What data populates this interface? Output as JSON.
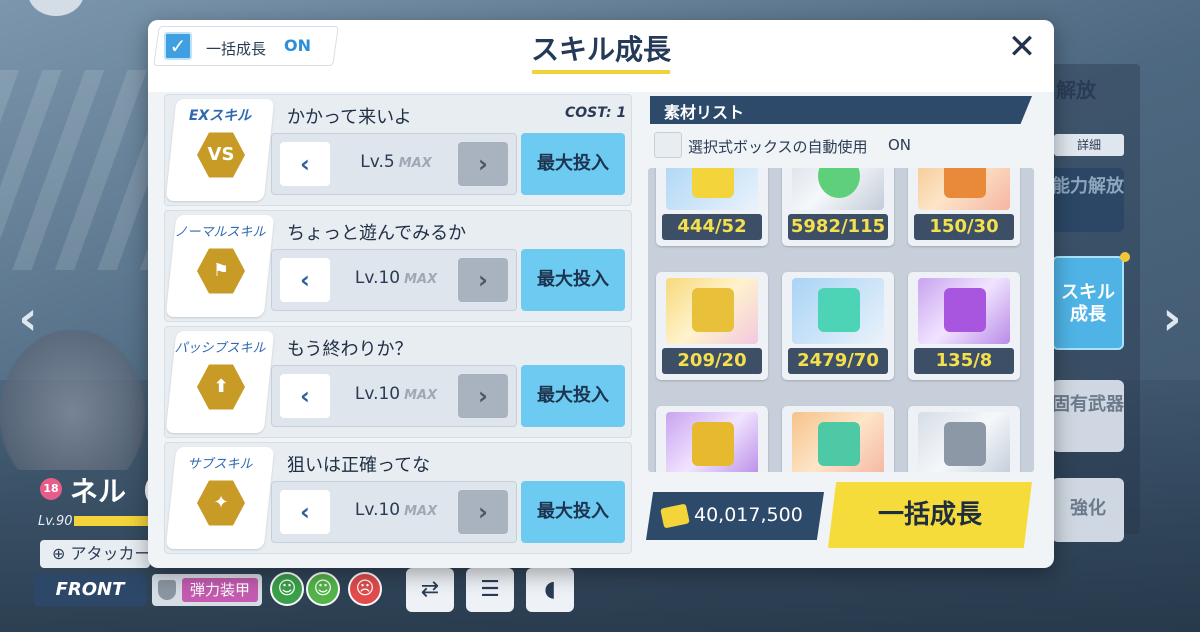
{
  "background": {
    "right_panel": {
      "title": "解放",
      "detail": "詳細",
      "buttons": [
        "能力解放",
        "スキル成長",
        "固有武器",
        "強化"
      ]
    },
    "character": {
      "heart_level": "18",
      "name": "ネル（",
      "level": "Lv.90",
      "role": "アタッカー",
      "position": "FRONT",
      "armor": "弾力装甲"
    }
  },
  "modal": {
    "bulk_toggle": {
      "label": "一括成長",
      "state": "ON"
    },
    "title": "スキル成長",
    "close": "✕"
  },
  "skills": [
    {
      "type": "EXスキル",
      "name": "かかって来いよ",
      "cost_label": "COST",
      "cost": ": 1",
      "level": "Lv.5",
      "max_tag": "MAX",
      "button": "最大投入",
      "icon": "VS"
    },
    {
      "type": "ノーマルスキル",
      "name": "ちょっと遊んでみるか",
      "level": "Lv.10",
      "max_tag": "MAX",
      "button": "最大投入",
      "icon": "⚑"
    },
    {
      "type": "パッシブスキル",
      "name": "もう終わりか？",
      "level": "Lv.10",
      "max_tag": "MAX",
      "button": "最大投入",
      "icon": "⬆"
    },
    {
      "type": "サブスキル",
      "name": "狙いは正確ってな",
      "level": "Lv.10",
      "max_tag": "MAX",
      "button": "最大投入",
      "icon": "✦"
    }
  ],
  "materials": {
    "title": "素材リスト",
    "auto_use_label": "選択式ボックスの自動使用",
    "auto_use_state": "ON",
    "items": [
      {
        "name": "gold-trophy-icon",
        "count": "444/52",
        "color": "#f3d43a"
      },
      {
        "name": "green-orbs-icon",
        "count": "5982/115",
        "color": "#5ecf7a"
      },
      {
        "name": "ex-disc-orange-icon",
        "count": "150/30",
        "color": "#e98a3b"
      },
      {
        "name": "gold-trophy-icon",
        "count": "209/20",
        "color": "#e8c03a"
      },
      {
        "name": "green-jar-icon",
        "count": "2479/70",
        "color": "#4dd3b5"
      },
      {
        "name": "ex-disc-purple-icon",
        "count": "135/8",
        "color": "#a855e0"
      },
      {
        "name": "gold-trophy-icon",
        "count": "",
        "color": "#e6b92e"
      },
      {
        "name": "green-drink-icon",
        "count": "",
        "color": "#4ec9a5"
      },
      {
        "name": "silver-card-icon",
        "count": "",
        "color": "#8d98a6"
      }
    ]
  },
  "footer": {
    "credits": "40,017,500",
    "bulk_grow_button": "一括成長"
  }
}
